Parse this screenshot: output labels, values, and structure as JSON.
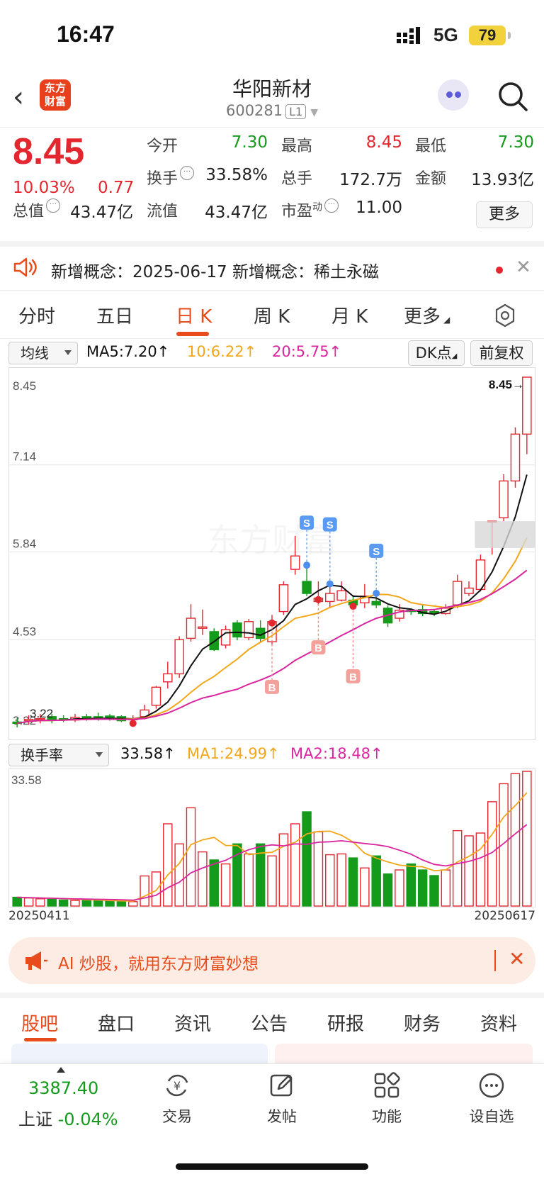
{
  "status": {
    "time": "16:47",
    "network": "5G",
    "battery": "79"
  },
  "header": {
    "logo_line1": "东方",
    "logo_line2": "财富",
    "name": "华阳新材",
    "code": "600281",
    "level": "L1"
  },
  "quote": {
    "price": "8.45",
    "change_pct": "10.03%",
    "change": "0.77",
    "labels": {
      "open": "今开",
      "high": "最高",
      "low": "最低",
      "turnover": "换手",
      "volume": "总手",
      "amount": "金额",
      "total_mv": "总值",
      "float_mv": "流值",
      "pe": "市盈",
      "pe_sup": "动"
    },
    "values": {
      "open": "7.30",
      "high": "8.45",
      "low": "7.30",
      "turnover": "33.58%",
      "volume": "172.7万",
      "amount": "13.93亿",
      "total_mv": "43.47亿",
      "float_mv": "43.47亿",
      "pe": "11.00"
    },
    "more_label": "更多"
  },
  "notice": {
    "text": "新增概念：2025-06-17 新增概念：稀土永磁"
  },
  "tabs": [
    "分时",
    "五日",
    "日 K",
    "周 K",
    "月 K",
    "更多"
  ],
  "active_tab": 2,
  "ma_bar": {
    "selector": "均线",
    "ma5": "MA5:7.20↑",
    "ma10": "10:6.22↑",
    "ma20": "20:5.75↑",
    "dk": "DK点",
    "adjust": "前复权"
  },
  "vol_bar": {
    "selector": "换手率",
    "value": "33.58↑",
    "ma1": "MA1:24.99↑",
    "ma2": "MA2:18.48↑"
  },
  "dates": {
    "start": "20250411",
    "end": "20250617"
  },
  "chart_data": {
    "type": "candlestick",
    "y_ticks": [
      "8.45",
      "7.14",
      "5.84",
      "4.53",
      "3.22"
    ],
    "ylim": [
      3.22,
      8.45
    ],
    "last_price_label": "8.45→",
    "low_label": "3.22",
    "watermark": "东方财富",
    "candles": [
      {
        "o": 3.3,
        "c": 3.28,
        "h": 3.36,
        "l": 3.22
      },
      {
        "o": 3.32,
        "c": 3.34,
        "h": 3.4,
        "l": 3.26
      },
      {
        "o": 3.34,
        "c": 3.35,
        "h": 3.42,
        "l": 3.28
      },
      {
        "o": 3.38,
        "c": 3.33,
        "h": 3.42,
        "l": 3.28
      },
      {
        "o": 3.35,
        "c": 3.34,
        "h": 3.4,
        "l": 3.3
      },
      {
        "o": 3.33,
        "c": 3.37,
        "h": 3.42,
        "l": 3.3
      },
      {
        "o": 3.38,
        "c": 3.36,
        "h": 3.42,
        "l": 3.32
      },
      {
        "o": 3.38,
        "c": 3.37,
        "h": 3.44,
        "l": 3.32
      },
      {
        "o": 3.39,
        "c": 3.34,
        "h": 3.42,
        "l": 3.32
      },
      {
        "o": 3.38,
        "c": 3.32,
        "h": 3.4,
        "l": 3.3
      },
      {
        "o": 3.34,
        "c": 3.35,
        "h": 3.4,
        "l": 3.3
      },
      {
        "o": 3.38,
        "c": 3.48,
        "h": 3.56,
        "l": 3.34
      },
      {
        "o": 3.55,
        "c": 3.82,
        "h": 3.84,
        "l": 3.5
      },
      {
        "o": 3.9,
        "c": 4.02,
        "h": 4.2,
        "l": 3.8
      },
      {
        "o": 4.02,
        "c": 4.53,
        "h": 4.58,
        "l": 3.96
      },
      {
        "o": 4.55,
        "c": 4.85,
        "h": 5.06,
        "l": 4.5
      },
      {
        "o": 4.7,
        "c": 4.72,
        "h": 4.98,
        "l": 4.6
      },
      {
        "o": 4.65,
        "c": 4.38,
        "h": 4.7,
        "l": 4.36
      },
      {
        "o": 4.45,
        "c": 4.68,
        "h": 4.74,
        "l": 4.4
      },
      {
        "o": 4.78,
        "c": 4.57,
        "h": 4.82,
        "l": 4.52
      },
      {
        "o": 4.56,
        "c": 4.8,
        "h": 4.84,
        "l": 4.52
      },
      {
        "o": 4.7,
        "c": 4.55,
        "h": 4.82,
        "l": 4.48
      },
      {
        "o": 4.5,
        "c": 4.8,
        "h": 4.9,
        "l": 4.46
      },
      {
        "o": 4.95,
        "c": 5.35,
        "h": 5.4,
        "l": 4.9
      },
      {
        "o": 5.58,
        "c": 5.78,
        "h": 6.08,
        "l": 5.5
      },
      {
        "o": 5.4,
        "c": 5.22,
        "h": 5.6,
        "l": 5.18
      },
      {
        "o": 5.1,
        "c": 5.15,
        "h": 5.4,
        "l": 5.05
      },
      {
        "o": 5.1,
        "c": 5.22,
        "h": 5.32,
        "l": 5.0
      },
      {
        "o": 5.12,
        "c": 5.26,
        "h": 5.4,
        "l": 5.1
      },
      {
        "o": 5.12,
        "c": 5.05,
        "h": 5.2,
        "l": 5.0
      },
      {
        "o": 5.08,
        "c": 5.18,
        "h": 5.36,
        "l": 5.0
      },
      {
        "o": 5.1,
        "c": 5.05,
        "h": 5.18,
        "l": 5.0
      },
      {
        "o": 5.0,
        "c": 4.78,
        "h": 5.04,
        "l": 4.72
      },
      {
        "o": 4.85,
        "c": 4.97,
        "h": 5.06,
        "l": 4.8
      },
      {
        "o": 4.97,
        "c": 4.95,
        "h": 5.0,
        "l": 4.9
      },
      {
        "o": 4.98,
        "c": 4.92,
        "h": 5.06,
        "l": 4.88
      },
      {
        "o": 4.95,
        "c": 4.93,
        "h": 4.98,
        "l": 4.88
      },
      {
        "o": 4.92,
        "c": 5.0,
        "h": 5.06,
        "l": 4.9
      },
      {
        "o": 5.05,
        "c": 5.4,
        "h": 5.5,
        "l": 5.0
      },
      {
        "o": 5.22,
        "c": 5.3,
        "h": 5.4,
        "l": 5.18
      },
      {
        "o": 5.28,
        "c": 5.72,
        "h": 5.8,
        "l": 5.25
      },
      {
        "o": 6.3,
        "c": 6.3,
        "h": 6.3,
        "l": 5.8
      },
      {
        "o": 6.35,
        "c": 6.9,
        "h": 7.0,
        "l": 6.3
      },
      {
        "o": 6.9,
        "c": 7.6,
        "h": 7.7,
        "l": 6.8
      },
      {
        "o": 7.6,
        "c": 8.45,
        "h": 8.45,
        "l": 7.3
      }
    ],
    "signals": [
      {
        "i": 22,
        "kind": "B"
      },
      {
        "i": 25,
        "kind": "S"
      },
      {
        "i": 26,
        "kind": "B"
      },
      {
        "i": 27,
        "kind": "S"
      },
      {
        "i": 29,
        "kind": "B"
      },
      {
        "i": 31,
        "kind": "S"
      }
    ],
    "turnover": {
      "ylim": [
        0,
        33.58
      ],
      "y_tick": "33.58",
      "values": [
        2.2,
        2.0,
        1.8,
        1.8,
        1.5,
        1.4,
        1.4,
        1.4,
        1.2,
        1.1,
        1.1,
        7.5,
        8.5,
        20.5,
        15.5,
        24.5,
        13.5,
        11.5,
        10.5,
        15.5,
        13.0,
        15.5,
        12.5,
        18.0,
        20.5,
        23.5,
        18.5,
        12.8,
        13.0,
        12.0,
        9.5,
        12.5,
        8.0,
        9.0,
        10.5,
        9.0,
        7.6,
        9.0,
        18.8,
        17.5,
        18.2,
        26.0,
        30.5,
        33.0,
        33.58
      ]
    }
  },
  "ad": {
    "text": "AI 炒股，就用东方财富妙想"
  },
  "subtabs": [
    "股吧",
    "盘口",
    "资讯",
    "公告",
    "研报",
    "财务",
    "资料"
  ],
  "bottom": {
    "index_value": "3387.40",
    "index_name": "上证",
    "index_change": "-0.04%",
    "items": [
      "交易",
      "发帖",
      "功能",
      "设自选"
    ]
  }
}
